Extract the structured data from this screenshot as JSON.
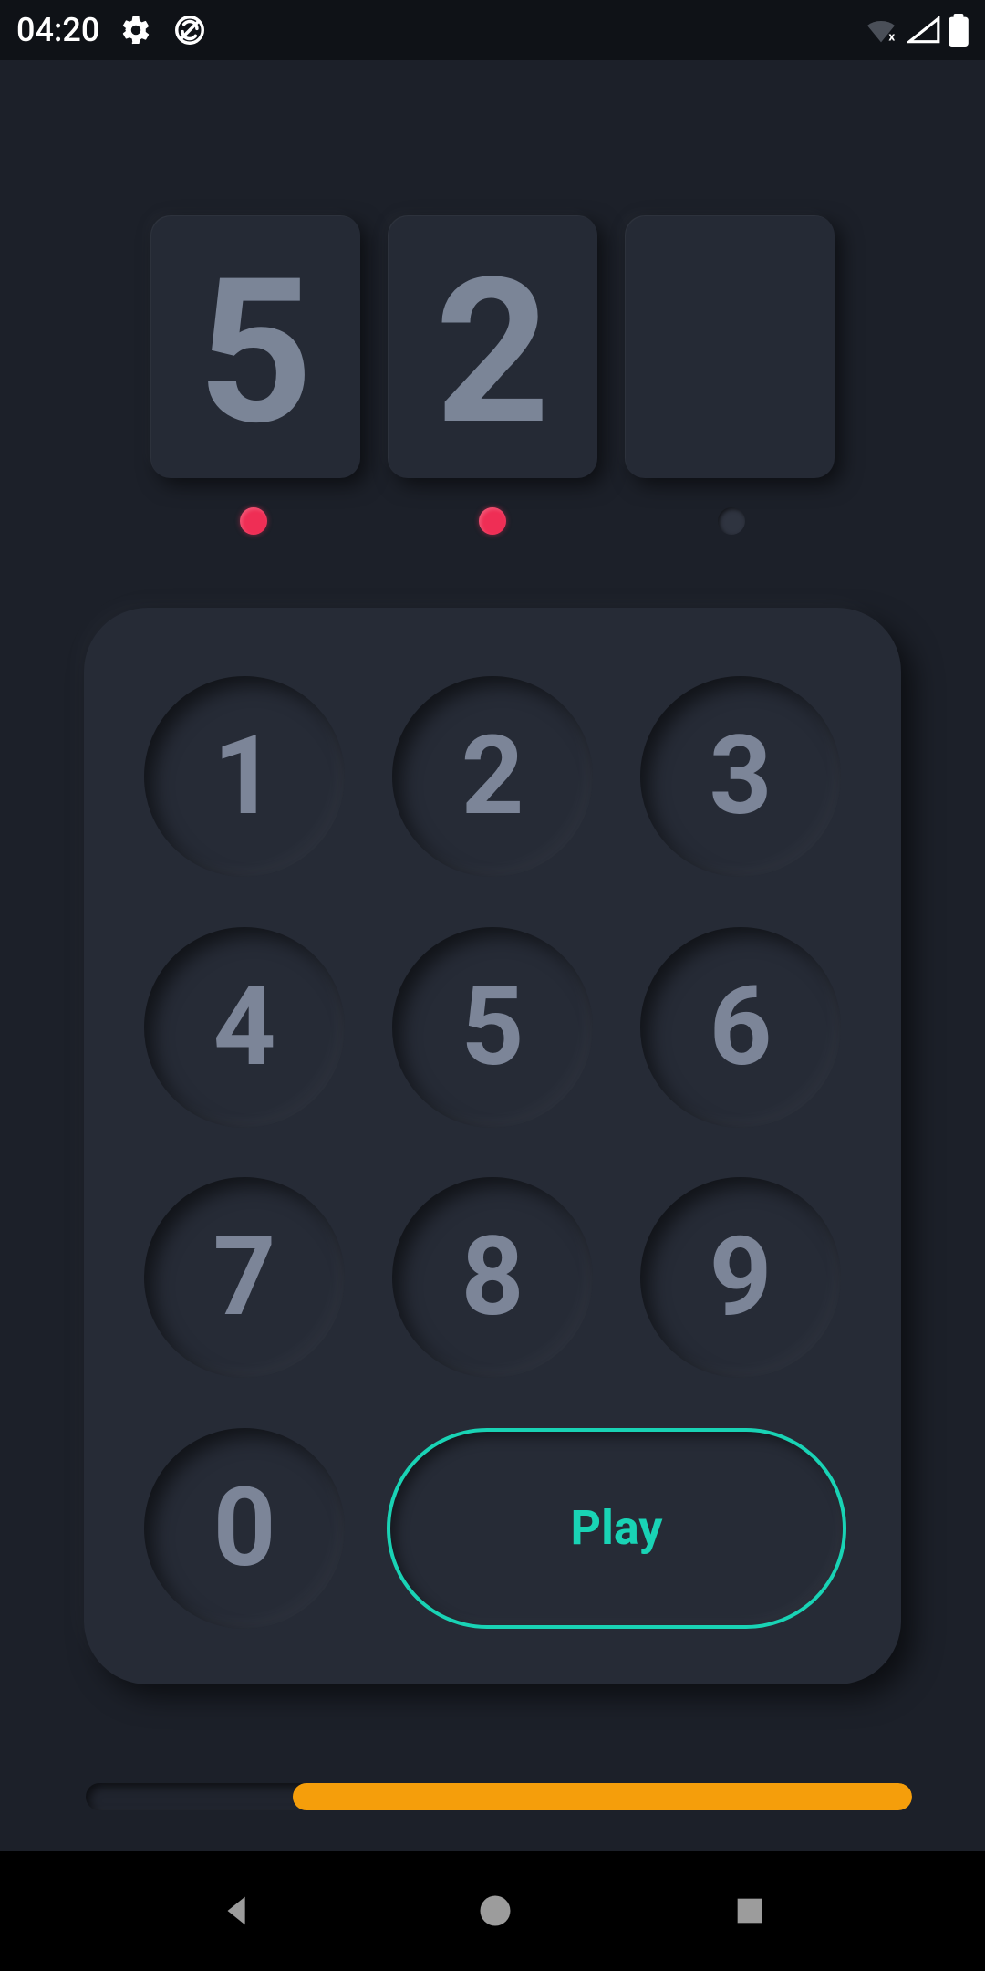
{
  "status": {
    "time": "04:20"
  },
  "display": {
    "digits": [
      "5",
      "2",
      ""
    ],
    "dots_filled": [
      true,
      true,
      false
    ]
  },
  "keypad": {
    "keys": [
      "1",
      "2",
      "3",
      "4",
      "5",
      "6",
      "7",
      "8",
      "9",
      "0"
    ],
    "play_label": "Play"
  },
  "progress": {
    "percent_remaining": 75
  },
  "colors": {
    "accent": "#19d3b5",
    "dot_filled": "#ef2e55",
    "progress": "#f59e0b"
  }
}
